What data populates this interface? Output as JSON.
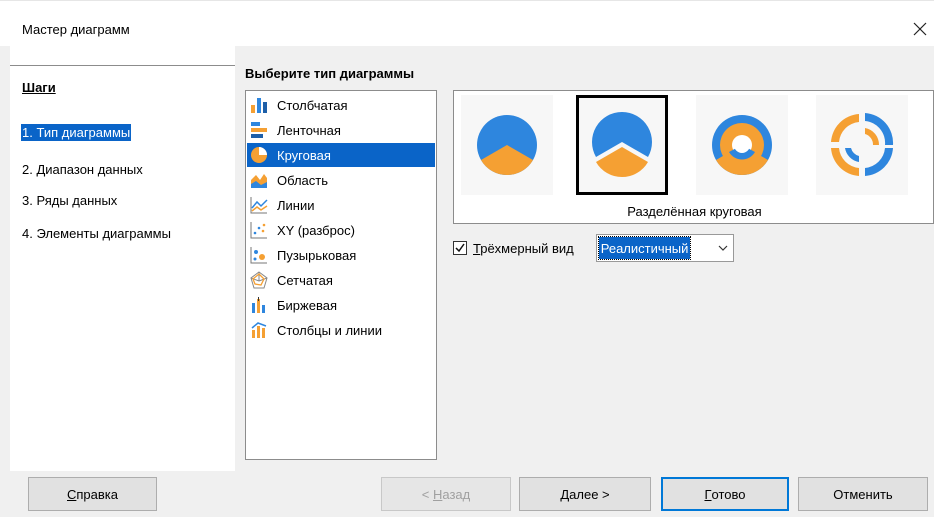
{
  "window": {
    "title": "Мастер диаграмм",
    "close_glyph": "×"
  },
  "steps": {
    "title": "Шаги",
    "items": [
      {
        "label": "1. Тип диаграммы",
        "active": true
      },
      {
        "label": "2. Диапазон данных",
        "active": false
      },
      {
        "label": "3. Ряды данных",
        "active": false
      },
      {
        "label": "4. Элементы диаграммы",
        "active": false
      }
    ]
  },
  "chart_type": {
    "heading": "Выберите тип диаграммы",
    "types": [
      {
        "label": "Столбчатая",
        "icon": "bar-chart-icon"
      },
      {
        "label": "Ленточная",
        "icon": "horizontal-bar-chart-icon"
      },
      {
        "label": "Круговая",
        "icon": "pie-chart-icon",
        "selected": true
      },
      {
        "label": "Область",
        "icon": "area-chart-icon"
      },
      {
        "label": "Линии",
        "icon": "line-chart-icon"
      },
      {
        "label": "XY (разброс)",
        "icon": "scatter-chart-icon"
      },
      {
        "label": "Пузырьковая",
        "icon": "bubble-chart-icon"
      },
      {
        "label": "Сетчатая",
        "icon": "net-chart-icon"
      },
      {
        "label": "Биржевая",
        "icon": "stock-chart-icon"
      },
      {
        "label": "Столбцы и линии",
        "icon": "column-line-chart-icon"
      }
    ],
    "variants": [
      {
        "name": "pie",
        "selected": false
      },
      {
        "name": "exploded-pie",
        "selected": true
      },
      {
        "name": "donut",
        "selected": false
      },
      {
        "name": "exploded-donut",
        "selected": false
      }
    ],
    "variant_caption": "Разделённая круговая",
    "three_d": {
      "checked": true,
      "label_accel": "Т",
      "label_rest": "рёхмерный вид",
      "scheme_value": "Реалистичный"
    }
  },
  "buttons": {
    "help": {
      "accel": "С",
      "rest": "правка"
    },
    "back": {
      "prefix": "< ",
      "accel": "Н",
      "rest": "азад"
    },
    "next": {
      "accel": "Д",
      "rest": "алее >"
    },
    "finish": {
      "accel": "Г",
      "rest": "отово"
    },
    "cancel": {
      "label": "Отменить"
    }
  },
  "colors": {
    "accent": "#0a64c8",
    "pie_blue": "#2e86de",
    "pie_orange": "#f5a033"
  }
}
